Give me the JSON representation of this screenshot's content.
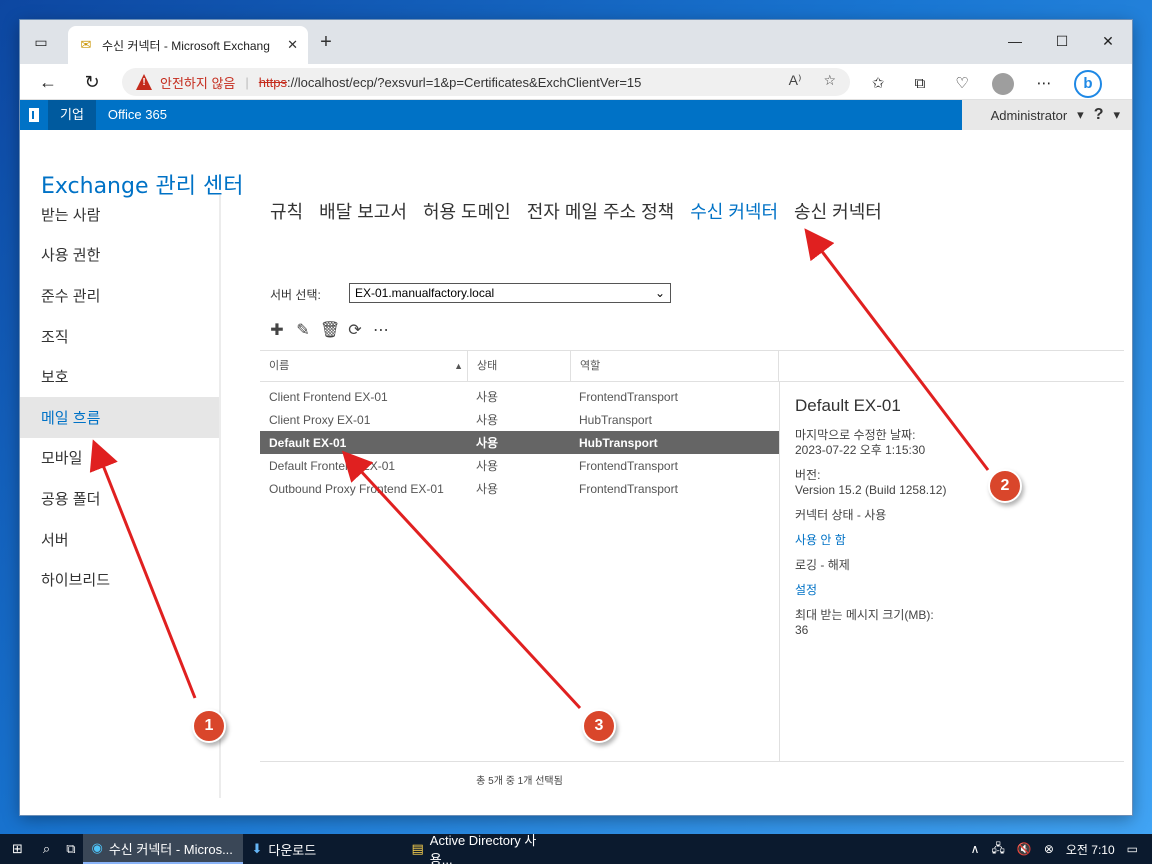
{
  "browser": {
    "tab_title": "수신 커넥터 - Microsoft Exchang",
    "security_warning": "안전하지 않음",
    "url_scheme": "https",
    "url_rest": "://localhost/ecp/?exsvurl=1&p=Certificates&ExchClientVer=15",
    "notification_badge": "1"
  },
  "ecp": {
    "nav_enterprise": "기업",
    "nav_office365": "Office 365",
    "user": "Administrator",
    "help": "?",
    "title": "Exchange 관리 센터"
  },
  "leftnav": {
    "items": [
      {
        "label": "받는 사람"
      },
      {
        "label": "사용 권한"
      },
      {
        "label": "준수 관리"
      },
      {
        "label": "조직"
      },
      {
        "label": "보호"
      },
      {
        "label": "메일 흐름"
      },
      {
        "label": "모바일"
      },
      {
        "label": "공용 폴더"
      },
      {
        "label": "서버"
      },
      {
        "label": "하이브리드"
      }
    ]
  },
  "subtabs": [
    {
      "label": "규칙"
    },
    {
      "label": "배달 보고서"
    },
    {
      "label": "허용 도메인"
    },
    {
      "label": "전자 메일 주소 정책"
    },
    {
      "label": "수신 커넥터"
    },
    {
      "label": "송신 커넥터"
    }
  ],
  "server_select": {
    "label": "서버 선택:",
    "value": "EX-01.manualfactory.local"
  },
  "table": {
    "headers": {
      "name": "이름",
      "status": "상태",
      "role": "역할"
    },
    "rows": [
      {
        "name": "Client Frontend EX-01",
        "status": "사용",
        "role": "FrontendTransport"
      },
      {
        "name": "Client Proxy EX-01",
        "status": "사용",
        "role": "HubTransport"
      },
      {
        "name": "Default EX-01",
        "status": "사용",
        "role": "HubTransport"
      },
      {
        "name": "Default Frontend EX-01",
        "status": "사용",
        "role": "FrontendTransport"
      },
      {
        "name": "Outbound Proxy Frontend EX-01",
        "status": "사용",
        "role": "FrontendTransport"
      }
    ],
    "footer": "총 5개 중 1개 선택됨"
  },
  "detail": {
    "title": "Default EX-01",
    "modified_label": "마지막으로 수정한 날짜:",
    "modified_value": "2023-07-22 오후 1:15:30",
    "version_label": "버전:",
    "version_value": "Version 15.2 (Build 1258.12)",
    "connector_status": "커넥터 상태 - 사용",
    "disable_link": "사용 안 함",
    "logging": "로깅 - 해제",
    "settings_link": "설정",
    "max_size_label": "최대 받는 메시지 크기(MB):",
    "max_size_value": "36"
  },
  "annotations": {
    "one": "1",
    "two": "2",
    "three": "3"
  },
  "taskbar": {
    "app_edge": "수신 커넥터 - Micros...",
    "app_downloads": "다운로드",
    "app_ad": "Active Directory 사용...",
    "clock": "오전 7:10"
  }
}
